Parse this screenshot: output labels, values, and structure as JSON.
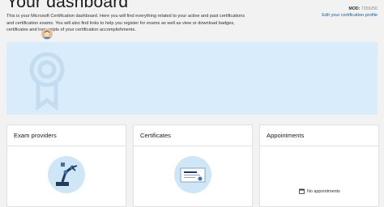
{
  "header": {
    "title": "Your dashboard",
    "intro": "This is your Microsoft Certification dashboard. Here you will find everything related to your active and past certifications and certification exams. You will also find links to help you register for exams as well as view or download badges, certificates and transcripts of your certification accomplishments.",
    "mod_label": "MOD:",
    "mod_value": "7355250",
    "edit_link": "Edit your certification profile"
  },
  "cards": [
    {
      "title": "Exam providers",
      "icon": "robot-arm-icon"
    },
    {
      "title": "Certificates",
      "icon": "certificate-icon"
    },
    {
      "title": "Appointments",
      "icon": "calendar-icon",
      "empty_text": "No appointments"
    }
  ],
  "colors": {
    "link": "#0067b8",
    "hero": "#d9ecfb",
    "icon_circle": "#cfe6f7",
    "page": "#f2f2f2"
  }
}
